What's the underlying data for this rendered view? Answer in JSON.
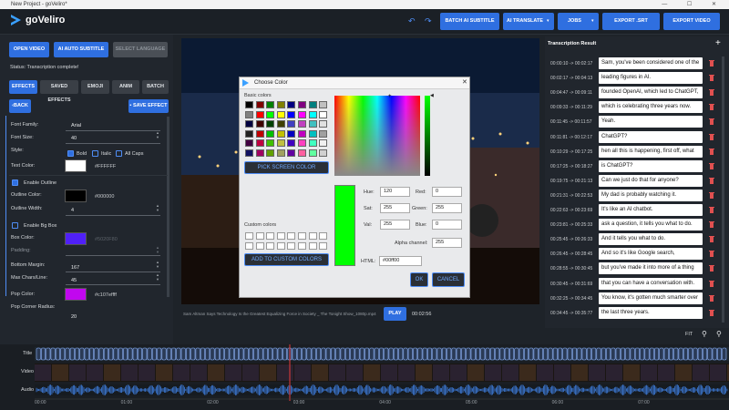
{
  "window": {
    "title": "New Project - goVeliro*",
    "controls": "—  ☐  ✕"
  },
  "app": {
    "name": "goVeliro"
  },
  "header": {
    "batch_ai_subtitle": "BATCH AI SUBTITLE",
    "ai_translate": "AI TRANSLATE",
    "jobs": "JOBS",
    "export_srt": "EXPORT .SRT",
    "export_video": "EXPORT VIDEO"
  },
  "left": {
    "open_video": "OPEN VIDEO",
    "ai_auto_subtitle": "AI AUTO SUBTITLE",
    "select_language": "SELECT LANGUAGE",
    "status": "Status: Transcription complete!",
    "tabs": [
      "EFFECTS",
      "SAVED EFFECTS",
      "EMOJI",
      "ANIM",
      "BATCH"
    ],
    "back": "BACK",
    "save_effect": "SAVE EFFECT",
    "font_family_label": "Font Family:",
    "font_family_value": "Arial",
    "font_size_label": "Font Size:",
    "font_size_value": "40",
    "style_label": "Style:",
    "bold": "Bold",
    "italic": "Italic",
    "all_caps": "All Caps",
    "text_color_label": "Text Color:",
    "text_color_value": "#FFFFFF",
    "enable_outline": "Enable Outline",
    "outline_color_label": "Outline Color:",
    "outline_color_value": "#000000",
    "outline_width_label": "Outline Width:",
    "outline_width_value": "4",
    "enable_bg_box": "Enable Bg Box",
    "box_color_label": "Box Color:",
    "box_color_value": "#5020F80",
    "padding_label": "Padding:",
    "bottom_margin_label": "Bottom Margin:",
    "bottom_margin_value": "167",
    "max_chars_label": "Max Chars/Line:",
    "max_chars_value": "45",
    "pop_color_label": "Pop Color:",
    "pop_color_value": "#c107effff",
    "pop_corner_label": "Pop Corner Radius:",
    "pop_corner_value": "20"
  },
  "player": {
    "filename": "Sam Altman Says Technology Is the Greatest Equalizing Force in Society _ The Tonight Show_1080p.mp4",
    "play": "PLAY",
    "time": "00:02:56"
  },
  "transcription": {
    "title": "Transcription Result",
    "add": "+",
    "rows": [
      {
        "time": "00:00:10 -> 00:02:17",
        "text": "Sam, you've been considered one of the"
      },
      {
        "time": "00:02:17 -> 00:04:13",
        "text": "leading figures in AI."
      },
      {
        "time": "00:04:47 -> 00:09:11",
        "text": "founded OpenAI, which led to ChatGPT,"
      },
      {
        "time": "00:09:33 -> 00:11:29",
        "text": "which is celebrating three years now."
      },
      {
        "time": "00:11:45 -> 00:11:57",
        "text": "Yeah."
      },
      {
        "time": "00:11:81 -> 00:12:17",
        "text": "ChatGPT?"
      },
      {
        "time": "00:10:29 -> 00:17:25",
        "text": "hen all this is happening, first off, what"
      },
      {
        "time": "00:17:25 -> 00:18:27",
        "text": "is ChatGPT?"
      },
      {
        "time": "00:19:75 -> 00:21:13",
        "text": "Can we just do that for anyone?"
      },
      {
        "time": "00:21:31 -> 00:22:53",
        "text": "My dad is probably watching it."
      },
      {
        "time": "00:22:63 -> 00:23:69",
        "text": "It's like an AI chatbot."
      },
      {
        "time": "00:23:81 -> 00:25:33",
        "text": "ask a question, it tells you what to do."
      },
      {
        "time": "00:25:45 -> 00:26:33",
        "text": "And it tells you what to do."
      },
      {
        "time": "00:26:45 -> 00:28:45",
        "text": "And so it's like Google search,"
      },
      {
        "time": "00:28:55 -> 00:30:45",
        "text": "but you've made it into more of a thing"
      },
      {
        "time": "00:30:45 -> 00:31:69",
        "text": "that you can have a conversation with."
      },
      {
        "time": "00:32:25 -> 00:34:45",
        "text": "You know, it's gotten much smarter over"
      },
      {
        "time": "00:34:45 -> 00:35:77",
        "text": "the last three years."
      }
    ]
  },
  "timeline": {
    "fit": "FIT",
    "tracks": [
      "Title",
      "Video",
      "Audio"
    ],
    "ticks": [
      "00:00",
      "01:00",
      "02:00",
      "03:00",
      "04:00",
      "05:00",
      "06:00",
      "07:00"
    ]
  },
  "dialog": {
    "title": "Choose Color",
    "basic_colors": "Basic colors",
    "pick_screen_color": "PICK SCREEN COLOR",
    "custom_colors": "Custom colors",
    "add_custom": "ADD TO CUSTOM COLORS",
    "hue_label": "Hue:",
    "hue_value": "120",
    "sat_label": "Sat:",
    "sat_value": "255",
    "val_label": "Val:",
    "val_value": "255",
    "red_label": "Red:",
    "red_value": "0",
    "green_label": "Green:",
    "green_value": "255",
    "blue_label": "Blue:",
    "blue_value": "0",
    "alpha_label": "Alpha channel:",
    "alpha_value": "255",
    "html_label": "HTML:",
    "html_value": "#00ff00",
    "ok": "OK",
    "cancel": "CANCEL",
    "current_color": "#00ff00",
    "basic_palette": [
      "#000000",
      "#800000",
      "#008000",
      "#808000",
      "#000080",
      "#800080",
      "#008080",
      "#c0c0c0",
      "#808080",
      "#ff0000",
      "#00ff00",
      "#ffff00",
      "#0000ff",
      "#ff00ff",
      "#00ffff",
      "#ffffff",
      "#000040",
      "#400000",
      "#004000",
      "#404000",
      "#4040c0",
      "#c040c0",
      "#40c0c0",
      "#e0e0e0",
      "#202020",
      "#c00000",
      "#00c000",
      "#c0c000",
      "#0000c0",
      "#c000c0",
      "#00c0c0",
      "#a0a0a0",
      "#400040",
      "#c00040",
      "#40c000",
      "#c0c040",
      "#4000c0",
      "#ff40c0",
      "#40ffc0",
      "#f0f0f0",
      "#101060",
      "#a00060",
      "#60a000",
      "#a0a060",
      "#6000a0",
      "#ff60a0",
      "#60ffa0",
      "#d0d0d0"
    ]
  }
}
